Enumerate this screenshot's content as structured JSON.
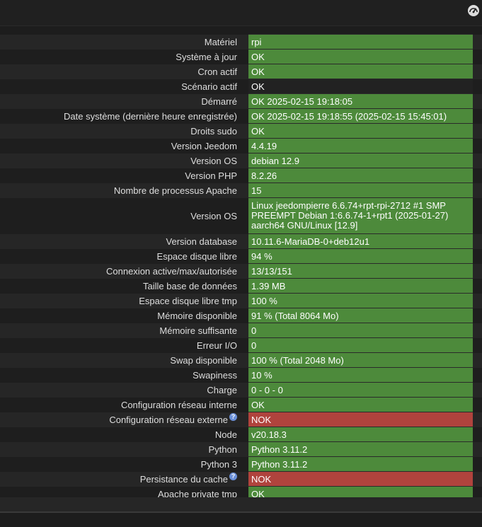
{
  "header": {
    "icon": "gauge-icon"
  },
  "rows": [
    {
      "label": "Matériel",
      "value": "rpi",
      "status": "ok"
    },
    {
      "label": "Système à jour",
      "value": "OK",
      "status": "ok"
    },
    {
      "label": "Cron actif",
      "value": "OK",
      "status": "ok"
    },
    {
      "label": "Scénario actif",
      "value": "OK",
      "status": "neutral"
    },
    {
      "label": "Démarré",
      "value": "OK 2025-02-15 19:18:05",
      "status": "ok"
    },
    {
      "label": "Date système (dernière heure enregistrée)",
      "value": "OK 2025-02-15 19:18:55 (2025-02-15 15:45:01)",
      "status": "ok"
    },
    {
      "label": "Droits sudo",
      "value": "OK",
      "status": "ok"
    },
    {
      "label": "Version Jeedom",
      "value": "4.4.19",
      "status": "ok"
    },
    {
      "label": "Version OS",
      "value": "debian 12.9",
      "status": "ok"
    },
    {
      "label": "Version PHP",
      "value": "8.2.26",
      "status": "ok"
    },
    {
      "label": "Nombre de processus Apache",
      "value": "15",
      "status": "ok"
    },
    {
      "label": "Version OS",
      "value": "Linux jeedompierre 6.6.74+rpt-rpi-2712 #1 SMP PREEMPT Debian 1:6.6.74-1+rpt1 (2025-01-27) aarch64 GNU/Linux [12.9]",
      "status": "ok",
      "tall": true
    },
    {
      "label": "Version database",
      "value": "10.11.6-MariaDB-0+deb12u1",
      "status": "ok"
    },
    {
      "label": "Espace disque libre",
      "value": "94 %",
      "status": "ok"
    },
    {
      "label": "Connexion active/max/autorisée",
      "value": "13/13/151",
      "status": "ok"
    },
    {
      "label": "Taille base de données",
      "value": "1.39 MB",
      "status": "ok"
    },
    {
      "label": "Espace disque libre tmp",
      "value": "100 %",
      "status": "ok"
    },
    {
      "label": "Mémoire disponible",
      "value": "91 % (Total 8064 Mo)",
      "status": "ok"
    },
    {
      "label": "Mémoire suffisante",
      "value": "0",
      "status": "ok"
    },
    {
      "label": "Erreur I/O",
      "value": "0",
      "status": "ok"
    },
    {
      "label": "Swap disponible",
      "value": "100 % (Total 2048 Mo)",
      "status": "ok"
    },
    {
      "label": "Swapiness",
      "value": "10 %",
      "status": "ok"
    },
    {
      "label": "Charge",
      "value": "0 - 0 - 0",
      "status": "ok"
    },
    {
      "label": "Configuration réseau interne",
      "value": "OK",
      "status": "ok"
    },
    {
      "label": "Configuration réseau externe",
      "value": "NOK",
      "status": "nok",
      "help": true
    },
    {
      "label": "Node",
      "value": "v20.18.3",
      "status": "ok"
    },
    {
      "label": "Python",
      "value": "Python 3.11.2",
      "status": "ok"
    },
    {
      "label": "Python 3",
      "value": "Python 3.11.2",
      "status": "ok"
    },
    {
      "label": "Persistance du cache",
      "value": "NOK",
      "status": "nok",
      "help": true
    },
    {
      "label": "Apache private tmp",
      "value": "OK",
      "status": "ok"
    }
  ],
  "help_glyph": "?",
  "colors": {
    "ok": "#4d8a3b",
    "nok": "#b0433d",
    "background": "#1d1d1d",
    "help": "#6a8fd8"
  }
}
